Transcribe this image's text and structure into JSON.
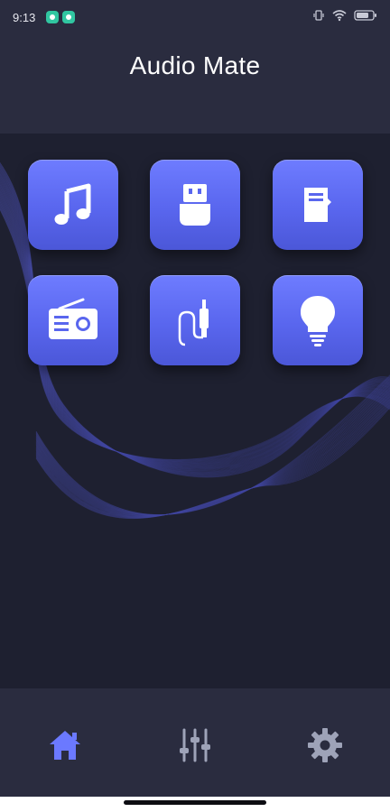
{
  "status_bar": {
    "time": "9:13",
    "icons": [
      "notification-app-icon",
      "notification-app-icon",
      "vibrate-icon",
      "wifi-icon",
      "battery-icon"
    ]
  },
  "header": {
    "title": "Audio Mate"
  },
  "tiles": [
    {
      "icon": "music-note-icon"
    },
    {
      "icon": "usb-drive-icon"
    },
    {
      "icon": "sd-card-icon"
    },
    {
      "icon": "radio-icon"
    },
    {
      "icon": "aux-cable-icon"
    },
    {
      "icon": "light-bulb-icon"
    }
  ],
  "bottom_nav": {
    "items": [
      {
        "icon": "home-icon",
        "active": true
      },
      {
        "icon": "equalizer-icon",
        "active": false
      },
      {
        "icon": "gear-icon",
        "active": false
      }
    ],
    "active_color": "#6b79ff",
    "inactive_color": "#9ea3b8"
  },
  "colors": {
    "background": "#1e2030",
    "header_bg": "#2a2c3f",
    "tile_accent": "#5f6cf2"
  }
}
